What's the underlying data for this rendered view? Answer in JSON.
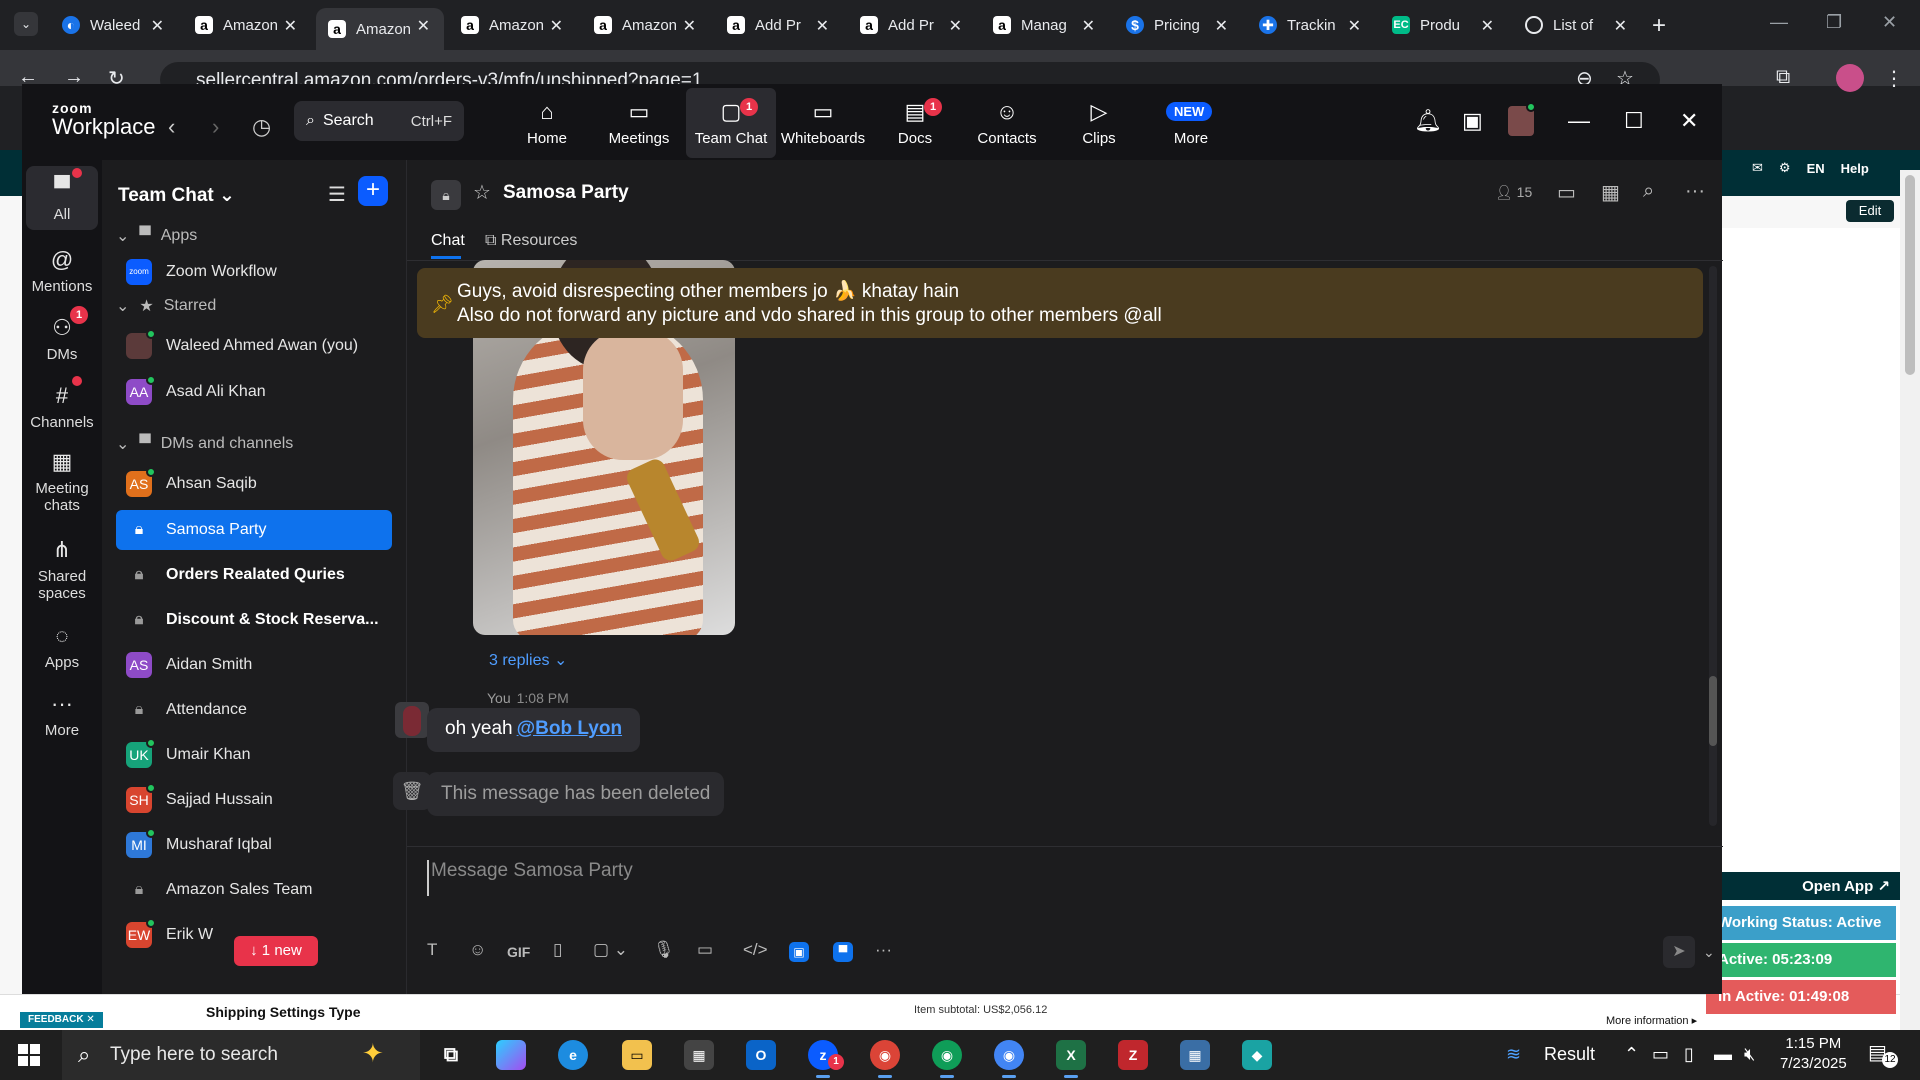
{
  "browser": {
    "tabs": [
      {
        "label": "Waleed",
        "icon": "globe-icon"
      },
      {
        "label": "Amazon",
        "icon": "amazon-icon"
      },
      {
        "label": "Amazon",
        "icon": "amazon-icon",
        "active": true
      },
      {
        "label": "Amazon",
        "icon": "amazon-icon"
      },
      {
        "label": "Amazon",
        "icon": "amazon-icon"
      },
      {
        "label": "Add Pr",
        "icon": "amazon-icon"
      },
      {
        "label": "Add Pr",
        "icon": "amazon-icon"
      },
      {
        "label": "Manag",
        "icon": "amazon-icon"
      },
      {
        "label": "Pricing",
        "icon": "dollar-icon"
      },
      {
        "label": "Trackin",
        "icon": "tracking-icon"
      },
      {
        "label": "Produ",
        "icon": "ec-icon"
      },
      {
        "label": "List of",
        "icon": "openai-icon"
      }
    ],
    "url": "sellercentral.amazon.com/orders-v3/mfn/unshipped?page=1"
  },
  "zoom": {
    "logo_top": "zoom",
    "logo_bottom": "Workplace",
    "search_label": "Search",
    "search_shortcut": "Ctrl+F",
    "nav_tabs": [
      {
        "label": "Home",
        "icon": "home-icon"
      },
      {
        "label": "Meetings",
        "icon": "video-camera-icon"
      },
      {
        "label": "Team Chat",
        "icon": "chat-icon",
        "badge": "1",
        "active": true
      },
      {
        "label": "Whiteboards",
        "icon": "whiteboard-icon"
      },
      {
        "label": "Docs",
        "icon": "document-icon",
        "badge": "1"
      },
      {
        "label": "Contacts",
        "icon": "contacts-icon"
      },
      {
        "label": "Clips",
        "icon": "clips-icon"
      },
      {
        "label": "More",
        "icon": "more-icon",
        "new_badge": "NEW"
      }
    ],
    "rail": [
      {
        "label": "All",
        "icon": "chat-bubble-icon",
        "dot": true,
        "active": true
      },
      {
        "label": "Mentions",
        "icon": "at-icon"
      },
      {
        "label": "DMs",
        "icon": "people-icon",
        "badge": "1"
      },
      {
        "label": "Channels",
        "icon": "hash-icon",
        "dot": true
      },
      {
        "label": "Meeting chats",
        "icon": "calendar-icon"
      },
      {
        "label": "Shared spaces",
        "icon": "share-icon"
      },
      {
        "label": "Apps",
        "icon": "apps-icon"
      },
      {
        "label": "More",
        "icon": "ellipsis-icon"
      }
    ],
    "sidebar": {
      "title": "Team Chat",
      "sections": {
        "apps": "Apps",
        "starred": "Starred",
        "dms": "DMs and channels"
      },
      "apps_items": [
        {
          "label": "Zoom Workflow"
        }
      ],
      "starred_items": [
        {
          "label": "Waleed Ahmed Awan (you)"
        },
        {
          "label": "Asad Ali Khan",
          "initials": "AA"
        }
      ],
      "dm_items": [
        {
          "label": "Ahsan Saqib",
          "initials": "AS"
        },
        {
          "label": "Samosa Party",
          "type": "channel",
          "selected": true
        },
        {
          "label": "Orders Realated Quries",
          "type": "channel",
          "bold": true
        },
        {
          "label": "Discount & Stock Reserva...",
          "type": "channel",
          "bold": true
        },
        {
          "label": "Aidan Smith",
          "initials": "AS"
        },
        {
          "label": "Attendance",
          "type": "channel"
        },
        {
          "label": "Umair Khan",
          "initials": "UK"
        },
        {
          "label": "Sajjad Hussain",
          "initials": "SH"
        },
        {
          "label": "Musharaf Iqbal",
          "initials": "MI"
        },
        {
          "label": "Amazon Sales Team",
          "type": "channel"
        },
        {
          "label": "Erik W",
          "initials": "EW"
        }
      ],
      "new_pill": "↓ 1 new"
    },
    "channel": {
      "name": "Samosa Party",
      "member_count": "15",
      "tabs": [
        "Chat",
        "Resources"
      ],
      "pinned_line1": "Guys, avoid disrespecting other members jo 🍌 khatay hain",
      "pinned_line2": "Also do not forward any picture and vdo shared in this group to other members @all",
      "replies": "3 replies",
      "message": {
        "author": "You",
        "time": "1:08 PM",
        "text": "oh yeah",
        "mention": "@Bob Lyon"
      },
      "deleted_text": "This message has been deleted",
      "composer_placeholder": "Message Samosa Party"
    }
  },
  "sellercentral": {
    "lang": "EN",
    "help": "Help",
    "edit": "Edit",
    "feedback": "FEEDBACK",
    "shipping_label": "Shipping Settings Type",
    "subtotal": "Item subtotal: US$2,056.12",
    "more_info": "More information",
    "open_app": "Open App",
    "working_status": "Working Status: Active",
    "active_time": "Active: 05:23:09",
    "inactive_time": "In Active: 01:49:08"
  },
  "taskbar": {
    "search_placeholder": "Type here to search",
    "weather": "Result",
    "time": "1:15 PM",
    "date": "7/23/2025",
    "notifications": "12",
    "zoom_badge": "1"
  },
  "colors": {
    "zoom_blue": "#0e72ed",
    "pinned_bg": "#4a3b1f",
    "badge_red": "#e8334a",
    "online_green": "#22c55e"
  }
}
